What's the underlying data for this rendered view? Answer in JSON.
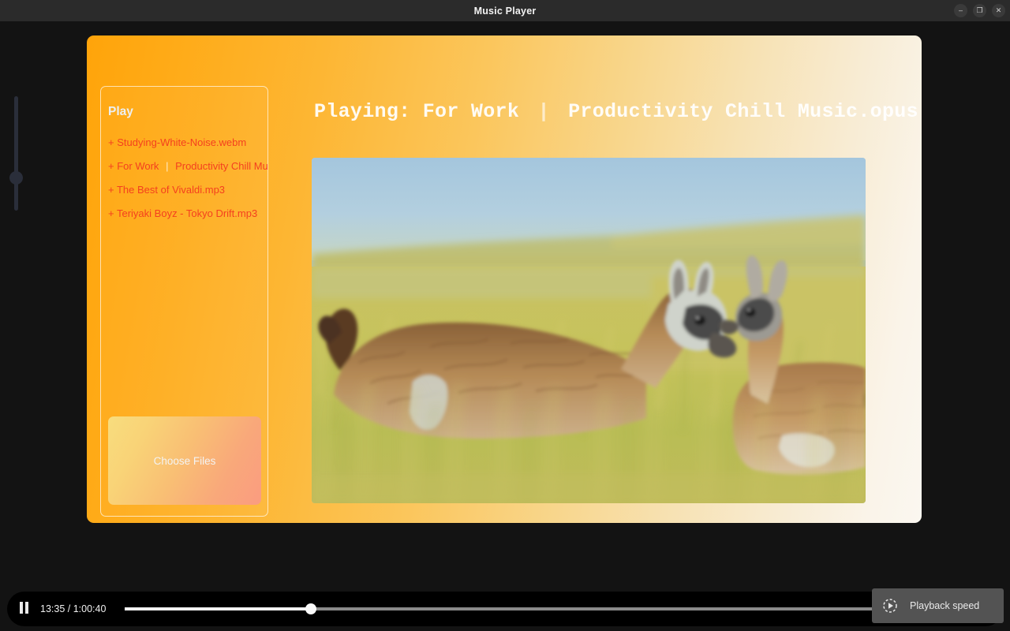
{
  "window": {
    "title": "Music Player",
    "buttons": [
      {
        "name": "minimize-button",
        "glyph": "–"
      },
      {
        "name": "maximize-button",
        "glyph": "❐"
      },
      {
        "name": "close-button",
        "glyph": "✕"
      }
    ]
  },
  "volume_slider": {
    "icon": "vertical-volume-slider",
    "orientation": "vertical",
    "thumb_position_percent": 34
  },
  "playlist": {
    "heading": "Play",
    "items": [
      {
        "prefix": "+",
        "title": "Studying-White-Noise.webm",
        "separator": "",
        "subtitle": ""
      },
      {
        "prefix": "+",
        "title": "For Work",
        "separator": "|",
        "subtitle": "Productivity Chill Musi"
      },
      {
        "prefix": "+",
        "title": "The Best of Vivaldi.mp3",
        "separator": "",
        "subtitle": ""
      },
      {
        "prefix": "+",
        "title": "Teriyaki Boyz - Tokyo Drift.mp3",
        "separator": "",
        "subtitle": ""
      }
    ],
    "choose_files_label": "Choose Files"
  },
  "now_playing": {
    "prefix": "Playing: For Work",
    "separator": "|",
    "suffix": "Productivity Chill Music.opus"
  },
  "artwork": {
    "alt": "Two guanacos nuzzling in tall golden grass under a pale blue sky",
    "sky_color": "#a9c9dd",
    "grass_color": "#c7bf5e",
    "animal_color": "#b1804f"
  },
  "controls": {
    "play_pause_icon": "pause-icon",
    "play_pause_state": "playing",
    "current_time": "13:35",
    "duration": "1:00:40",
    "time_display": "13:35 / 1:00:40",
    "progress_percent": 24,
    "seek_label": "seek-slider"
  },
  "tooltip": {
    "icon": "playback-speed-icon",
    "label": "Playback speed"
  },
  "colors": {
    "panel_start": "#ffa40a",
    "panel_end": "#fbf7f0",
    "playlist_text": "#f4401f",
    "titlebar": "#2b2b2b",
    "app_background": "#131313",
    "tooltip_background": "#535353"
  }
}
